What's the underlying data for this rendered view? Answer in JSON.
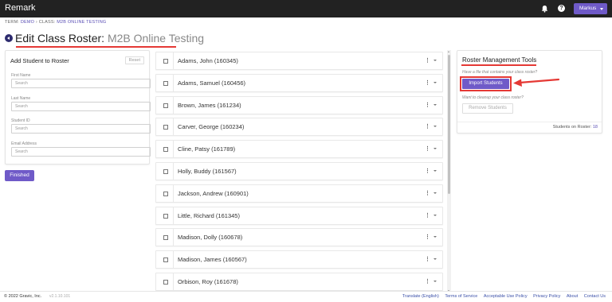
{
  "app": {
    "title": "Remark"
  },
  "header": {
    "user_label": "Markus",
    "bell_icon": "bell-icon",
    "help_icon": "help-icon"
  },
  "breadcrumb": {
    "term_label": "TERM:",
    "term_value": "DEMO",
    "separator": "›",
    "class_label": "CLASS:",
    "class_value": "M2B ONLINE TESTING"
  },
  "page": {
    "title": "Edit Class Roster:",
    "subtitle": "M2B Online Testing"
  },
  "add_student": {
    "title": "Add Student to Roster",
    "reset_label": "Reset",
    "fields": [
      {
        "label": "First Name",
        "placeholder": "Search"
      },
      {
        "label": "Last Name",
        "placeholder": "Search"
      },
      {
        "label": "Student ID",
        "placeholder": "Search"
      },
      {
        "label": "Email Address",
        "placeholder": "Search"
      }
    ],
    "finished_label": "Finished"
  },
  "roster": {
    "students": [
      "Adams, John (160345)",
      "Adams, Samuel (160456)",
      "Brown, James (161234)",
      "Carver, George (160234)",
      "Cline, Patsy (161789)",
      "Holly, Buddy (161567)",
      "Jackson, Andrew (160901)",
      "Little, Richard (161345)",
      "Madison, Dolly (160678)",
      "Madison, James (160567)",
      "Orbison, Roy (161678)"
    ]
  },
  "tools": {
    "title": "Roster Management Tools",
    "import_hint": "Have a file that contains your class roster?",
    "import_label": "Import Students",
    "cleanup_hint": "Want to cleanup your class roster?",
    "remove_label": "Remove Students",
    "count_label": "Students on Roster:",
    "count_value": "18"
  },
  "footer": {
    "copyright": "© 2022 Gravic, Inc.",
    "version": "v2.1.10.101",
    "links": [
      "Translate (English)",
      "Terms of Service",
      "Acceptable Use Policy",
      "Privacy Policy",
      "About",
      "Contact Us"
    ]
  },
  "colors": {
    "accent": "#6f5ac8",
    "topbar": "#222222",
    "annotation": "#e53935",
    "link": "#3a4fa8"
  }
}
